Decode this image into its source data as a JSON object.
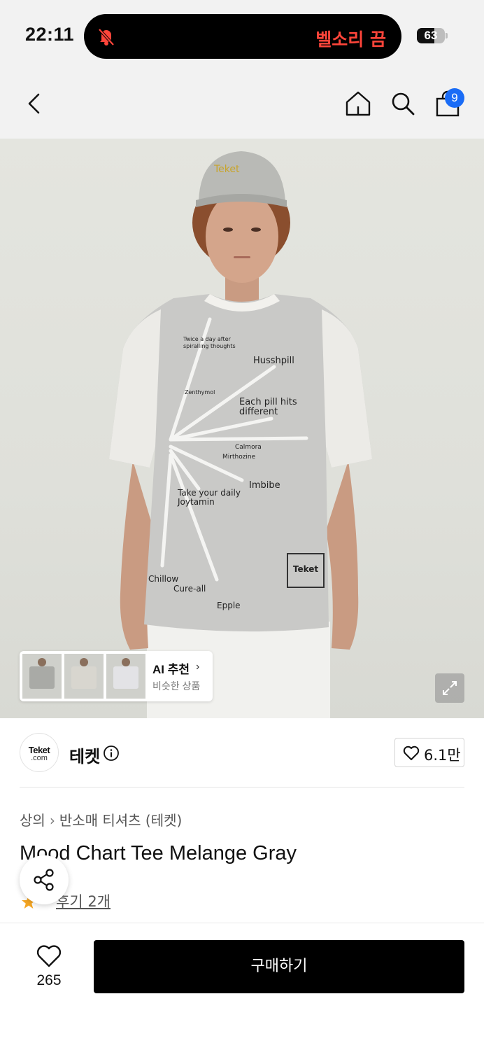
{
  "status_bar": {
    "time": "22:11",
    "silent_mode_text": "벨소리 끔",
    "battery_level": "63",
    "icons": [
      "bell-slash-icon",
      "battery-icon"
    ],
    "accent_color": "#ff453a"
  },
  "nav": {
    "icons": [
      "back-chevron-icon",
      "home-icon",
      "search-icon",
      "shopping-bag-icon"
    ],
    "cart_count": "9",
    "badge_color": "#1a6cf6"
  },
  "product_image": {
    "tee_print_texts": [
      "Twice a day after spiralling thoughts",
      "Husshpill",
      "Zenthymol",
      "Each pill hits different",
      "Calmora",
      "Mirthozine",
      "Imbibe",
      "Take your daily Joytamin",
      "Chillow",
      "Cure-all",
      "Epple"
    ],
    "cap_text": "Teket",
    "logo_text": "Teket",
    "ai_recommendation": {
      "title": "AI 추천",
      "subtitle": "비슷한 상품"
    },
    "expand_icon": "expand-icon"
  },
  "brand": {
    "logo_line1": "Teket",
    "logo_line2": ".com",
    "name": "테켓",
    "like_count": "6.1만"
  },
  "product": {
    "breadcrumb": [
      "상의",
      "반소매 티셔츠 (테켓)"
    ],
    "title": "Mood Chart Tee Melange Gray",
    "rating_star_color": "#f5a623",
    "review_link": "후기 2개"
  },
  "bottom_bar": {
    "wishlist_count": "265",
    "buy_label": "구매하기"
  }
}
